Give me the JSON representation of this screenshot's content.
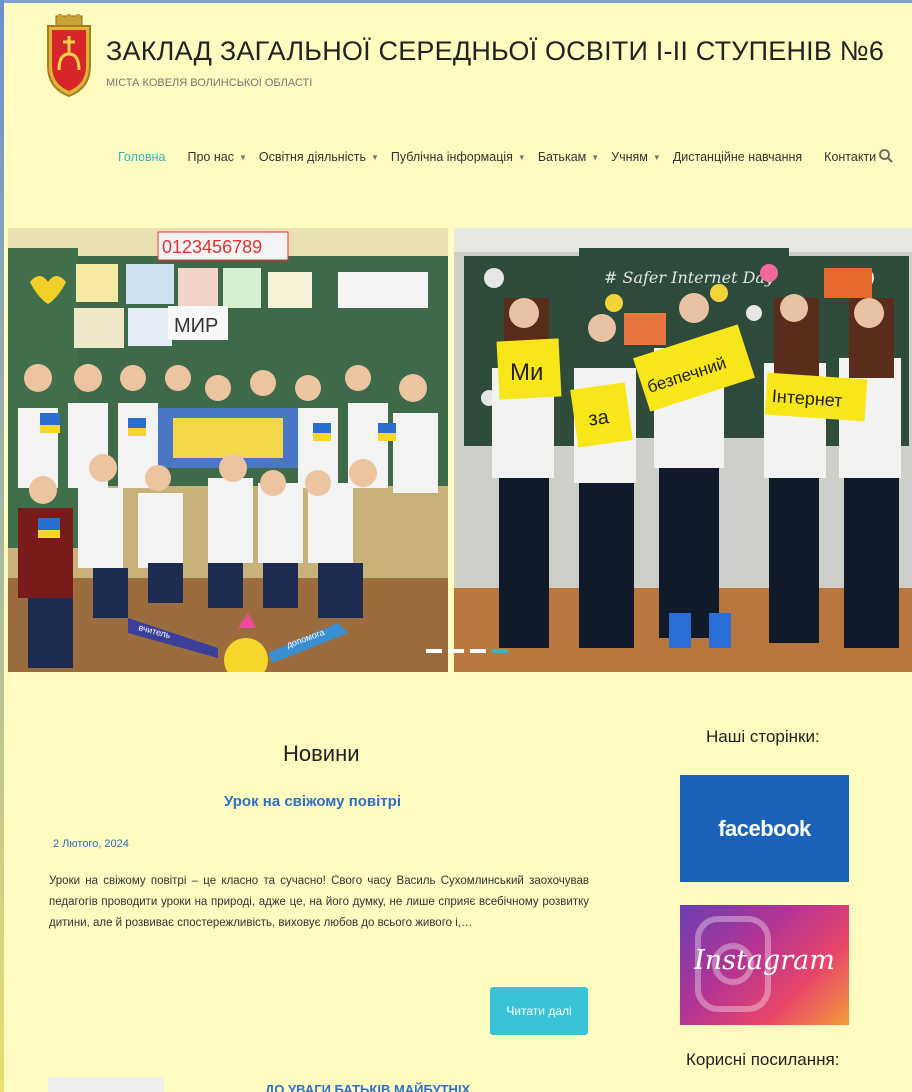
{
  "header": {
    "title": "ЗАКЛАД ЗАГАЛЬНОЇ СЕРЕДНЬОЇ ОСВІТИ І-ІІ СТУПЕНІВ №6",
    "subtitle": "МІСТА КОВЕЛЯ ВОЛИНСЬКОЇ ОБЛАСТІ",
    "logo_icon": "coat-of-arms-icon"
  },
  "nav": {
    "items": [
      {
        "label": "Головна",
        "active": true,
        "dropdown": false
      },
      {
        "label": "Про нас",
        "dropdown": true
      },
      {
        "label": "Освітня діяльність",
        "dropdown": true
      },
      {
        "label": "Публічна інформація",
        "dropdown": true
      },
      {
        "label": "Батькам",
        "dropdown": true
      },
      {
        "label": "Учням",
        "dropdown": true
      },
      {
        "label": "Дистанційне навчання",
        "dropdown": false
      },
      {
        "label": "Контакти",
        "dropdown": false
      }
    ],
    "search_icon": "search-icon",
    "accent": "#2fb7c6"
  },
  "slider": {
    "left_slide": {
      "board_digits": "0123456789",
      "poster_text": "МИР",
      "rays": [
        "вчитель",
        "допомога"
      ]
    },
    "right_slide": {
      "board_text": "# Safer Internet Day",
      "signs": [
        "Ми",
        "за",
        "безпечний",
        "Інтернет"
      ]
    },
    "dots_count": 4,
    "active_dot": 4
  },
  "news": {
    "heading": "Новини",
    "post": {
      "title": "Урок на свіжому повітрі",
      "date": "2 Лютого, 2024",
      "excerpt": "Уроки на свіжому повітрі – це класно та сучасно! Свого часу Василь Сухомлинський заохочував педагогів проводити уроки на природі, адже це, на його думку, не лише сприяє всебічному розвитку дитини, але й розвиває спостережливість, виховує любов до всього живого і,…",
      "read_more": "Читати далі"
    },
    "post2_title": "ДО УВАГИ БАТЬКІВ МАЙБУТНІХ"
  },
  "sidebar": {
    "pages_heading": "Наші сторінки:",
    "facebook_label": "facebook",
    "instagram_label": "Instagram",
    "links_heading": "Корисні посилання:"
  },
  "colors": {
    "background": "#fdfbc0",
    "link": "#2f6fc5",
    "button": "#39c3d6",
    "facebook": "#1b63b8"
  }
}
